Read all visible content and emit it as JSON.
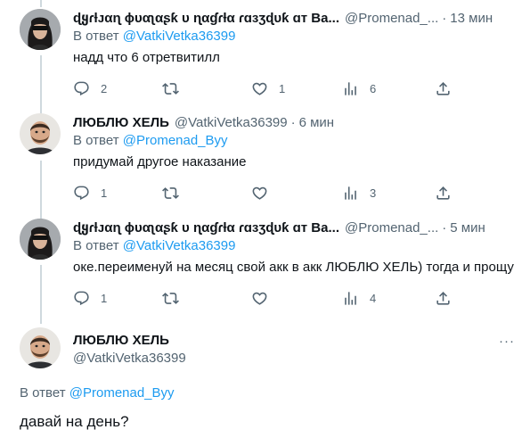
{
  "tweets": [
    {
      "name": "ɖყɾƚᴊαɳ ɸυαʅαʂƙ υ ɳαɠɾƚα ɾɑɜʒɖυƙ ɑт Ва...",
      "handle": "@Promenad_...",
      "dot": "·",
      "time": "13 мин",
      "reply_prefix": "В ответ",
      "reply_to": "@VatkiVetka36399",
      "text": "надд что 6 отретвитилл",
      "replies": "2",
      "retweets": "",
      "likes": "1",
      "views": "6",
      "avatar": "girl-avatar"
    },
    {
      "name": "ЛЮБЛЮ ХЕЛЬ",
      "handle": "@VatkiVetka36399",
      "dot": "·",
      "time": "6 мин",
      "reply_prefix": "В ответ",
      "reply_to": "@Promenad_Byy",
      "text": "придумай другое наказание",
      "replies": "1",
      "retweets": "",
      "likes": "",
      "views": "3",
      "avatar": "man-avatar"
    },
    {
      "name": "ɖყɾƚᴊαɳ ɸυαʅαʂƙ υ ɳαɠɾƚα ɾɑɜʒɖυƙ ɑт Ва...",
      "handle": "@Promenad_...",
      "dot": "·",
      "time": "5 мин",
      "reply_prefix": "В ответ",
      "reply_to": "@VatkiVetka36399",
      "text": "оке.переименуй на месяц свой акк в акк ЛЮБЛЮ ХЕЛЬ) тогда и прощу",
      "replies": "1",
      "retweets": "",
      "likes": "",
      "views": "4",
      "avatar": "girl-avatar"
    }
  ],
  "main": {
    "name": "ЛЮБЛЮ ХЕЛЬ",
    "handle": "@VatkiVetka36399",
    "reply_prefix": "В ответ",
    "reply_to": "@Promenad_Byy",
    "text": "давай на день?",
    "more": "···",
    "avatar": "man-avatar"
  },
  "more_glyph": "···",
  "colors": {
    "link": "#1d9bf0",
    "muted": "#536471",
    "line": "#cfd9de"
  },
  "icons": [
    "reply-icon",
    "retweet-icon",
    "like-icon",
    "views-icon",
    "share-icon",
    "more-icon"
  ]
}
